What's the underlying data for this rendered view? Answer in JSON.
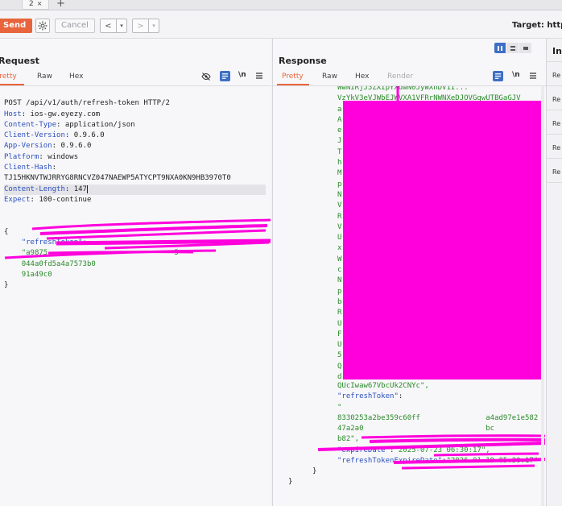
{
  "tabs": {
    "active_label": "2",
    "close_glyph": "×",
    "add_glyph": "+"
  },
  "toolbar": {
    "send_label": "Send",
    "cancel_label": "Cancel",
    "back_glyph": "<",
    "forward_glyph": ">",
    "dropdown_glyph": "▾",
    "target_label": "Target: https"
  },
  "request": {
    "title": "Request",
    "tabs": [
      "Pretty",
      "Raw",
      "Hex"
    ],
    "ln_label": "\\n",
    "lines": [
      {
        "text": "POST /api/v1/auth/refresh-token HTTP/2"
      },
      {
        "name": "Host",
        "value": "ios-gw.eyezy.com"
      },
      {
        "name": "Content-Type",
        "value": "application/json"
      },
      {
        "name": "Client-Version",
        "value": "0.9.6.0"
      },
      {
        "name": "App-Version",
        "value": "0.9.6.0"
      },
      {
        "name": "Platform",
        "value": "windows"
      },
      {
        "name": "Client-Hash",
        "value": ""
      },
      {
        "text": "TJ15HKNVTWJRRYG8RNCVZ047NAEWP5ATYCPT9NXA0KN9HB3970T0"
      },
      {
        "name": "Content-Length",
        "value": "147"
      },
      {
        "name": "Expect",
        "value": "100-continue"
      }
    ],
    "body": {
      "open": "{",
      "key": "\"refreshToken\"",
      "colon": ":",
      "val1": "\"a9875",
      "val1_end": "5",
      "val2": "044a0fd5a4a7573b0",
      "val3": "91a49c0",
      "close": "}"
    }
  },
  "response": {
    "title": "Response",
    "tabs": [
      "Pretty",
      "Raw",
      "Hex",
      "Render"
    ],
    "ln_label": "\\n",
    "top_lines": [
      "WwNIRjJ5ZXIpYXdwN0JyWXhDV1I...",
      "VzYkV3eVJWbEJWVXA1VFRrNWNXeDJOVGgwUTBGaGJV"
    ],
    "left_letters": [
      "a",
      "A",
      "e",
      "J",
      "T",
      "h",
      "M",
      "p",
      "N",
      "V",
      "R",
      "V",
      "U",
      "x",
      "W",
      "c",
      "N",
      "p",
      "b",
      "R",
      "U",
      "F",
      "U",
      "5",
      "Q",
      "d"
    ],
    "token_tail": "QUcIwaw67VbcUk2CNYc\",",
    "refresh_key": "\"refreshToken\"",
    "refresh_colon": ":",
    "refresh_val1": "\"",
    "refresh_val2": "8330253a2be359c60ff",
    "refresh_val2_end": "a4ad97e1e582",
    "refresh_val3": "47a2a0",
    "refresh_val3_end": "bc",
    "refresh_val4": "b82\",",
    "expire_key": "\"expireDate\"",
    "expire_val": "\"2025-07-23 06:30:17\",",
    "rexpire_key": "\"refreshTokenExpireDate\"",
    "rexpire_val": "\"2026-01-19 05:30:17\"",
    "close_inner": "}",
    "close_outer": "}"
  },
  "inspector": {
    "title": "In",
    "items": [
      "Re",
      "Re",
      "Re",
      "Re",
      "Re"
    ]
  },
  "colors": {
    "accent": "#e8643c",
    "redaction": "#ff00dd",
    "header_name": "#2b4fbf",
    "json_value": "#2a8a2a"
  }
}
